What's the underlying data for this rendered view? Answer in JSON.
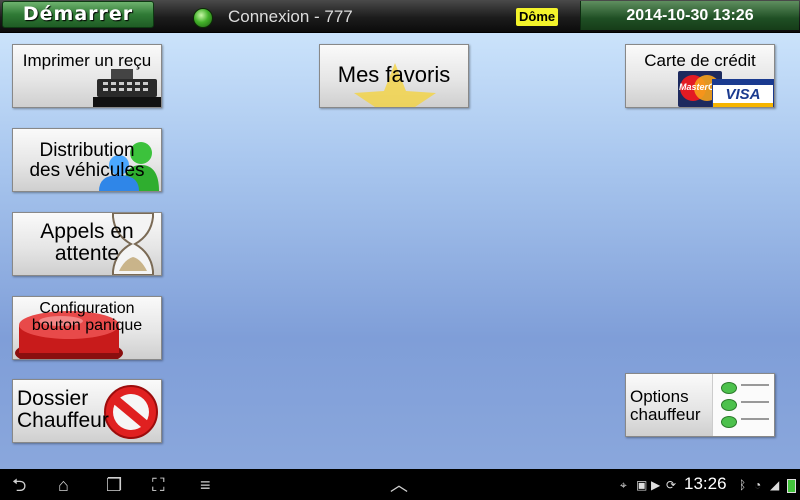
{
  "topbar": {
    "start_label": "Démarrer",
    "connection_text": "Connexion - 777",
    "dome_label": "Dôme",
    "datetime": "2014-10-30   13:26"
  },
  "tiles": {
    "print_receipt": "Imprimer un reçu",
    "favorites": "Mes favoris",
    "credit_card": "Carte de crédit",
    "vehicle_dist_line1": "Distribution",
    "vehicle_dist_line2": "des véhicules",
    "calls_line1": "Appels en",
    "calls_line2": "attente",
    "panic_line1": "Configuration",
    "panic_line2": "bouton panique",
    "driver_file_line1": "Dossier",
    "driver_file_line2": "Chauffeur",
    "driver_options_line1": "Options",
    "driver_options_line2": "chauffeur",
    "mastercard_text": "MasterCard",
    "visa_text": "VISA"
  },
  "statusbar": {
    "time": "13:26"
  }
}
